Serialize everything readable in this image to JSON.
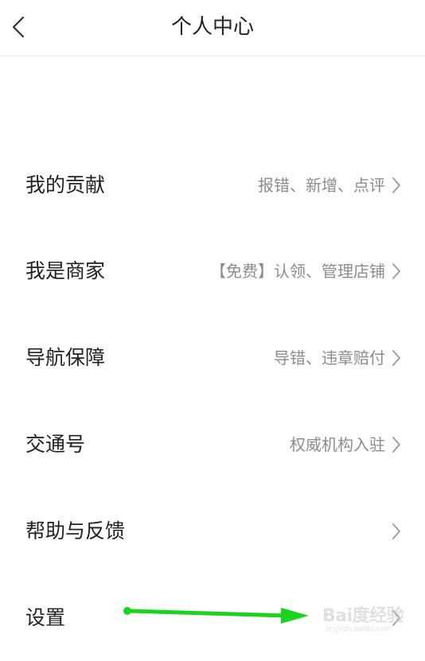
{
  "header": {
    "title": "个人中心",
    "back_icon": "chevron-left-icon"
  },
  "menu": {
    "items": [
      {
        "label": "我的贡献",
        "hint": "报错、新增、点评"
      },
      {
        "label": "我是商家",
        "hint": "【免费】认领、管理店铺"
      },
      {
        "label": "导航保障",
        "hint": "导错、违章赔付"
      },
      {
        "label": "交通号",
        "hint": "权威机构入驻"
      },
      {
        "label": "帮助与反馈",
        "hint": ""
      },
      {
        "label": "设置",
        "hint": ""
      }
    ],
    "chevron_icon": "chevron-right-icon"
  },
  "annotation": {
    "arrow_color": "#1ed31e"
  },
  "watermark": {
    "brand": "Bai度经验",
    "url": "jingyan.baidu.com"
  },
  "colors": {
    "text_primary": "#222222",
    "text_secondary": "#8c8c8c",
    "divider": "#e6e6e6"
  }
}
